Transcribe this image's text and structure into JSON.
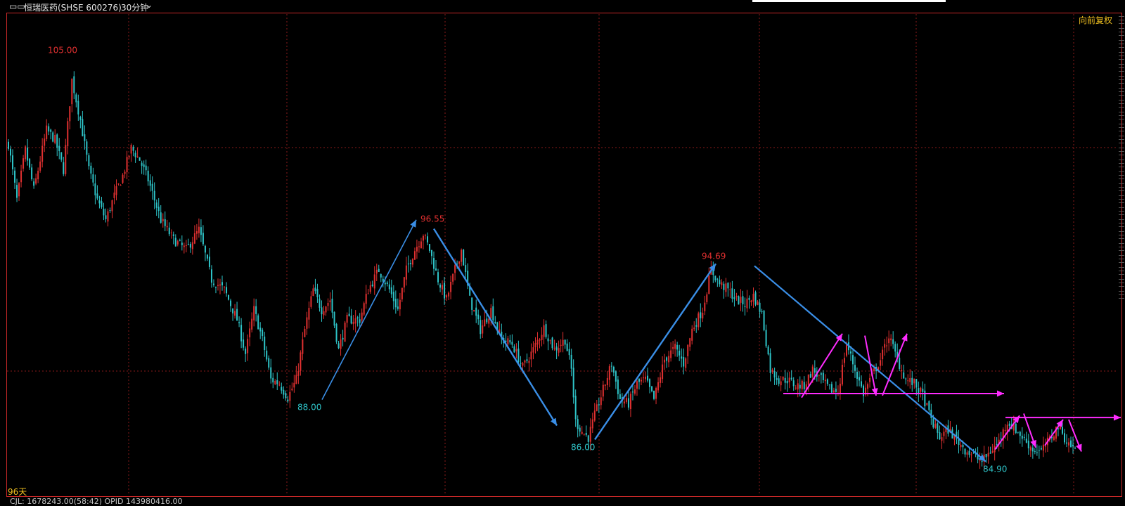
{
  "header": {
    "window_icon": "window-toggle-icon",
    "stock_title": "恒瑞医药(SHSE 600276)",
    "period_selector": "30分钟",
    "dropdown_icon": "chevron-down-icon"
  },
  "adjust_label": "向前复权",
  "period_count_label": "96天",
  "footer_text": "CJL:  1678243.00(58:42)  OPID 143980416.00",
  "colors": {
    "up": "#e03030",
    "down": "#2ec4c8",
    "grid": "#8a1a1a",
    "trend_blue": "#3a8ee6",
    "trend_magenta": "#ff2cff",
    "label_red": "#e03030",
    "label_cyan": "#2ec4c8"
  },
  "chart_data": {
    "type": "candlestick",
    "title": "恒瑞医药(SHSE 600276) 30分钟",
    "ylim": [
      83.2,
      107.3
    ],
    "grid": true,
    "annotations": [
      {
        "label": "105.00",
        "kind": "high",
        "value": 105.0
      },
      {
        "label": "88.00",
        "kind": "low",
        "value": 88.0
      },
      {
        "label": "96.55",
        "kind": "high",
        "value": 96.55
      },
      {
        "label": "86.00",
        "kind": "low",
        "value": 86.0
      },
      {
        "label": "94.69",
        "kind": "high",
        "value": 94.69
      },
      {
        "label": "84.90",
        "kind": "low",
        "value": 84.9
      }
    ],
    "trend_arrows_blue": [
      {
        "from": 88.0,
        "to": 97.0
      },
      {
        "from": 96.55,
        "to": 86.7
      },
      {
        "from": 86.0,
        "to": 94.8
      },
      {
        "from": 94.69,
        "to": 84.9
      }
    ],
    "trend_arrows_magenta": [
      {
        "from": 88.1,
        "to": 91.3
      },
      {
        "from": 91.2,
        "to": 88.2
      },
      {
        "from": 88.2,
        "to": 91.3
      },
      {
        "from": 85.5,
        "to": 87.2
      },
      {
        "from": 87.3,
        "to": 85.6
      },
      {
        "from": 85.7,
        "to": 87.0
      },
      {
        "from": 87.0,
        "to": 85.4
      }
    ],
    "horizontal_levels": [
      88.3,
      87.1
    ],
    "path_keypoints": [
      [
        0,
        100.8
      ],
      [
        4,
        98.0
      ],
      [
        8,
        100.5
      ],
      [
        12,
        98.5
      ],
      [
        18,
        101.5
      ],
      [
        22,
        101.0
      ],
      [
        26,
        99.5
      ],
      [
        30,
        104.0
      ],
      [
        34,
        102.0
      ],
      [
        38,
        99.5
      ],
      [
        42,
        98.0
      ],
      [
        46,
        97.0
      ],
      [
        50,
        98.2
      ],
      [
        54,
        99.2
      ],
      [
        58,
        100.6
      ],
      [
        62,
        100.0
      ],
      [
        66,
        99.0
      ],
      [
        72,
        97.0
      ],
      [
        78,
        96.0
      ],
      [
        84,
        95.5
      ],
      [
        90,
        96.5
      ],
      [
        96,
        94.0
      ],
      [
        102,
        93.5
      ],
      [
        108,
        92.0
      ],
      [
        112,
        90.3
      ],
      [
        116,
        92.5
      ],
      [
        120,
        91.0
      ],
      [
        124,
        89.0
      ],
      [
        128,
        88.8
      ],
      [
        132,
        88.1
      ],
      [
        136,
        89.0
      ],
      [
        140,
        91.5
      ],
      [
        144,
        93.5
      ],
      [
        148,
        92.5
      ],
      [
        152,
        93.0
      ],
      [
        156,
        90.5
      ],
      [
        160,
        92.0
      ],
      [
        166,
        92.0
      ],
      [
        170,
        93.5
      ],
      [
        175,
        94.5
      ],
      [
        180,
        93.5
      ],
      [
        184,
        92.5
      ],
      [
        188,
        94.5
      ],
      [
        192,
        95.5
      ],
      [
        196,
        96.3
      ],
      [
        199,
        95.5
      ],
      [
        203,
        94.0
      ],
      [
        207,
        93.0
      ],
      [
        211,
        94.5
      ],
      [
        214,
        95.5
      ],
      [
        218,
        93.0
      ],
      [
        223,
        91.5
      ],
      [
        228,
        92.5
      ],
      [
        233,
        91.0
      ],
      [
        238,
        90.8
      ],
      [
        243,
        89.6
      ],
      [
        248,
        90.5
      ],
      [
        253,
        91.6
      ],
      [
        258,
        90.5
      ],
      [
        263,
        91.0
      ],
      [
        266,
        89.5
      ],
      [
        268,
        86.9
      ],
      [
        271,
        86.4
      ],
      [
        274,
        86.1
      ],
      [
        277,
        87.2
      ],
      [
        281,
        88.5
      ],
      [
        285,
        89.8
      ],
      [
        289,
        88.0
      ],
      [
        293,
        87.8
      ],
      [
        297,
        88.8
      ],
      [
        301,
        89.0
      ],
      [
        305,
        88.0
      ],
      [
        310,
        90.0
      ],
      [
        315,
        90.6
      ],
      [
        319,
        89.8
      ],
      [
        323,
        91.5
      ],
      [
        328,
        92.5
      ],
      [
        332,
        94.5
      ],
      [
        336,
        93.8
      ],
      [
        340,
        93.5
      ],
      [
        344,
        93.0
      ],
      [
        348,
        92.8
      ],
      [
        352,
        93.2
      ],
      [
        356,
        92.3
      ],
      [
        360,
        89.5
      ],
      [
        364,
        89.0
      ],
      [
        368,
        89.0
      ],
      [
        372,
        88.7
      ],
      [
        376,
        88.7
      ],
      [
        380,
        89.5
      ],
      [
        384,
        89.0
      ],
      [
        388,
        88.5
      ],
      [
        392,
        88.4
      ],
      [
        396,
        90.8
      ],
      [
        400,
        89.5
      ],
      [
        404,
        88.3
      ],
      [
        408,
        89.2
      ],
      [
        412,
        90.0
      ],
      [
        416,
        91.2
      ],
      [
        420,
        90.0
      ],
      [
        424,
        89.0
      ],
      [
        428,
        88.8
      ],
      [
        432,
        88.2
      ],
      [
        436,
        87.0
      ],
      [
        440,
        86.1
      ],
      [
        444,
        86.5
      ],
      [
        448,
        86.0
      ],
      [
        452,
        85.5
      ],
      [
        456,
        85.2
      ],
      [
        460,
        84.9
      ],
      [
        464,
        85.4
      ],
      [
        468,
        85.9
      ],
      [
        472,
        86.9
      ],
      [
        476,
        86.5
      ],
      [
        480,
        86.0
      ],
      [
        484,
        85.5
      ],
      [
        488,
        85.4
      ],
      [
        492,
        86.0
      ],
      [
        496,
        86.7
      ],
      [
        500,
        85.9
      ],
      [
        504,
        85.5
      ]
    ]
  }
}
